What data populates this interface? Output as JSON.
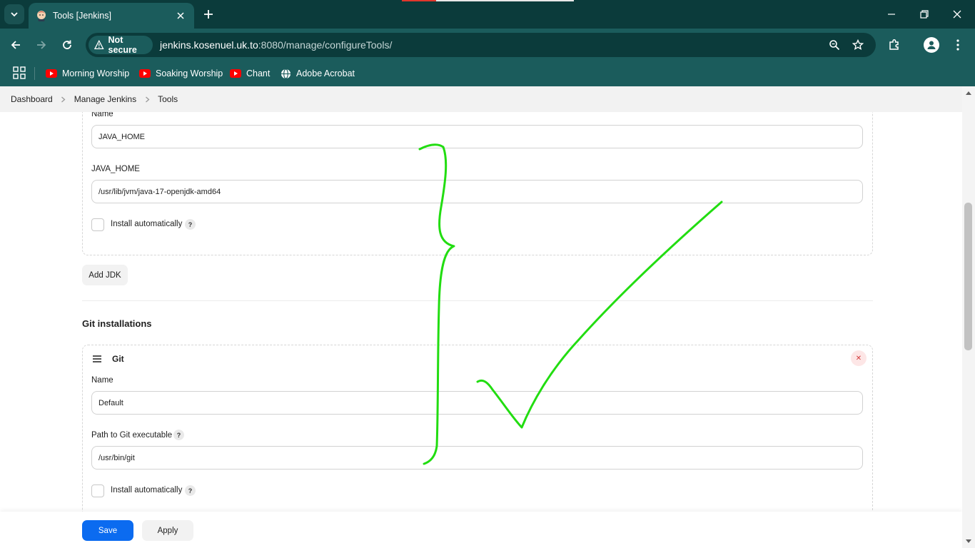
{
  "browser": {
    "tab_title": "Tools [Jenkins]",
    "security_label": "Not secure",
    "url_host": "jenkins.kosenuel.uk.to",
    "url_rest": ":8080/manage/configureTools/",
    "bookmarks": [
      {
        "label": "Morning Worship",
        "icon": "youtube-icon"
      },
      {
        "label": "Soaking Worship",
        "icon": "youtube-icon"
      },
      {
        "label": "Chant",
        "icon": "youtube-icon"
      },
      {
        "label": "Adobe Acrobat",
        "icon": "globe-icon"
      }
    ]
  },
  "breadcrumb": [
    "Dashboard",
    "Manage Jenkins",
    "Tools"
  ],
  "jdk": {
    "name_label": "Name",
    "name_value": "JAVA_HOME",
    "home_label": "JAVA_HOME",
    "home_value": "/usr/lib/jvm/java-17-openjdk-amd64",
    "install_label": "Install automatically",
    "help": "?",
    "add_button": "Add JDK"
  },
  "git": {
    "section_title": "Git installations",
    "item_title": "Git",
    "name_label": "Name",
    "name_value": "Default",
    "path_label": "Path to Git executable",
    "path_value": "/usr/bin/git",
    "install_label": "Install automatically",
    "help": "?",
    "delete_symbol": "✕"
  },
  "actions": {
    "save": "Save",
    "apply": "Apply"
  },
  "colors": {
    "browser_frame": "#0b3b3b",
    "browser_toolbar": "#1b5c5c",
    "primary_button": "#0b6bf0",
    "annotation_stroke": "#22dd11"
  }
}
